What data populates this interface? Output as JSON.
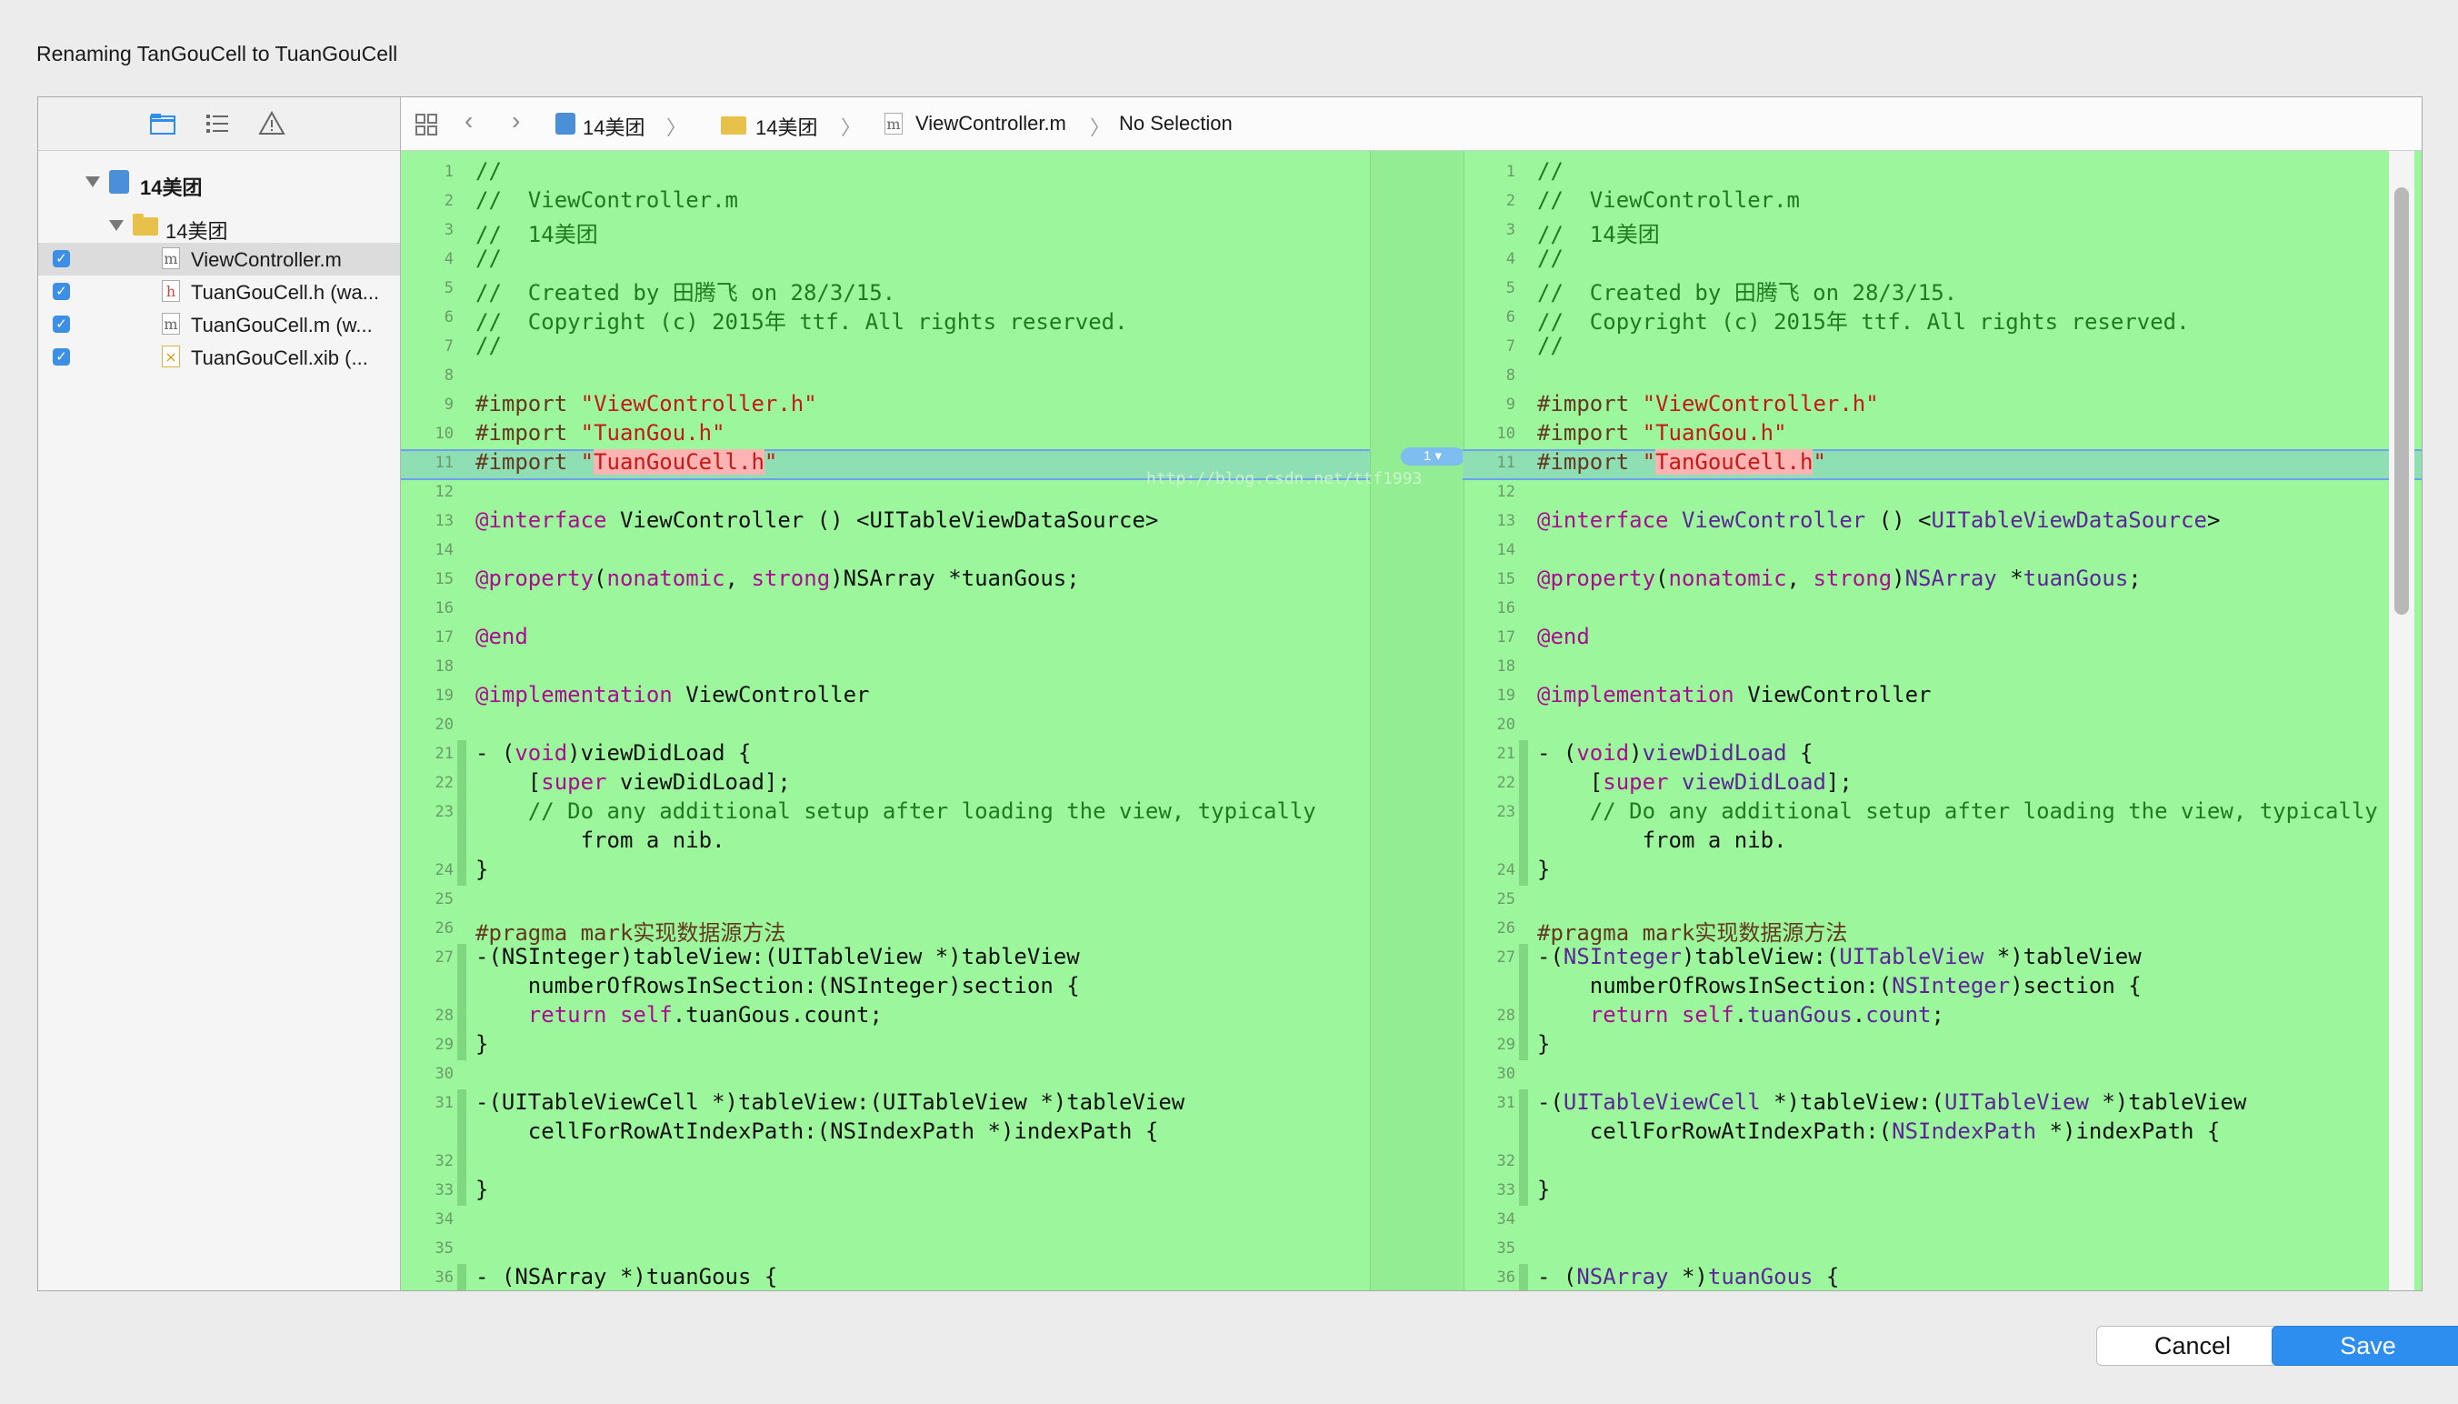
{
  "title": "Renaming TanGouCell to TuanGouCell",
  "sidebar": {
    "tools": [
      "folder-icon",
      "list-icon",
      "warning-icon"
    ],
    "project": "14美团",
    "group": "14美团",
    "files": [
      {
        "name": "ViewController.m",
        "checked": true,
        "icon": "m",
        "selected": true
      },
      {
        "name": "TuanGouCell.h (wa...",
        "checked": true,
        "icon": "h",
        "selected": false
      },
      {
        "name": "TuanGouCell.m (w...",
        "checked": true,
        "icon": "m",
        "selected": false
      },
      {
        "name": "TuanGouCell.xib (...",
        "checked": true,
        "icon": "x",
        "selected": false
      }
    ]
  },
  "breadcrumb": {
    "project": "14美团",
    "group": "14美团",
    "file": "ViewController.m",
    "selection": "No Selection"
  },
  "change_count": "1",
  "watermark": "http://blog.csdn.net/ttf1993",
  "line_numbers": [
    "1",
    "2",
    "3",
    "4",
    "5",
    "6",
    "7",
    "8",
    "9",
    "10",
    "11",
    "12",
    "13",
    "14",
    "15",
    "16",
    "17",
    "18",
    "19",
    "20",
    "21",
    "22",
    "23",
    "",
    "24",
    "25",
    "26",
    "27",
    "",
    "28",
    "29",
    "30",
    "31",
    "",
    "32",
    "33",
    "34",
    "35",
    "36"
  ],
  "left_code": [
    "//",
    "//  ViewController.m",
    "//  14美团",
    "//",
    "//  Created by 田腾飞 on 28/3/15.",
    "//  Copyright (c) 2015年 ttf. All rights reserved.",
    "//",
    "",
    "#import \"ViewController.h\"",
    "#import \"TuanGou.h\"",
    "#import \"TuanGouCell.h\"",
    "",
    "@interface ViewController () <UITableViewDataSource>",
    "",
    "@property(nonatomic, strong)NSArray *tuanGous;",
    "",
    "@end",
    "",
    "@implementation ViewController",
    "",
    "- (void)viewDidLoad {",
    "    [super viewDidLoad];",
    "    // Do any additional setup after loading the view, typically",
    "        from a nib.",
    "}",
    "",
    "#pragma mark实现数据源方法",
    "-(NSInteger)tableView:(UITableView *)tableView",
    "    numberOfRowsInSection:(NSInteger)section {",
    "    return self.tuanGous.count;",
    "}",
    "",
    "-(UITableViewCell *)tableView:(UITableView *)tableView",
    "    cellForRowAtIndexPath:(NSIndexPath *)indexPath {",
    "",
    "}",
    "",
    "",
    "- (NSArray *)tuanGous {"
  ],
  "right_code": [
    "//",
    "//  ViewController.m",
    "//  14美团",
    "//",
    "//  Created by 田腾飞 on 28/3/15.",
    "//  Copyright (c) 2015年 ttf. All rights reserved.",
    "//",
    "",
    "#import \"ViewController.h\"",
    "#import \"TuanGou.h\"",
    "#import \"TanGouCell.h\"",
    "",
    "@interface ViewController () <UITableViewDataSource>",
    "",
    "@property(nonatomic, strong)NSArray *tuanGous;",
    "",
    "@end",
    "",
    "@implementation ViewController",
    "",
    "- (void)viewDidLoad {",
    "    [super viewDidLoad];",
    "    // Do any additional setup after loading the view, typically",
    "        from a nib.",
    "}",
    "",
    "#pragma mark实现数据源方法",
    "-(NSInteger)tableView:(UITableView *)tableView",
    "    numberOfRowsInSection:(NSInteger)section {",
    "    return self.tuanGous.count;",
    "}",
    "",
    "-(UITableViewCell *)tableView:(UITableView *)tableView",
    "    cellForRowAtIndexPath:(NSIndexPath *)indexPath {",
    "",
    "}",
    "",
    "",
    "- (NSArray *)tuanGous {"
  ],
  "buttons": {
    "cancel": "Cancel",
    "save": "Save"
  },
  "colors": {
    "diff_bg": "#9cf79c",
    "accent": "#2d8ef0",
    "comment": "#207a20",
    "string": "#c41a16",
    "keyword": "#aa0d91"
  }
}
